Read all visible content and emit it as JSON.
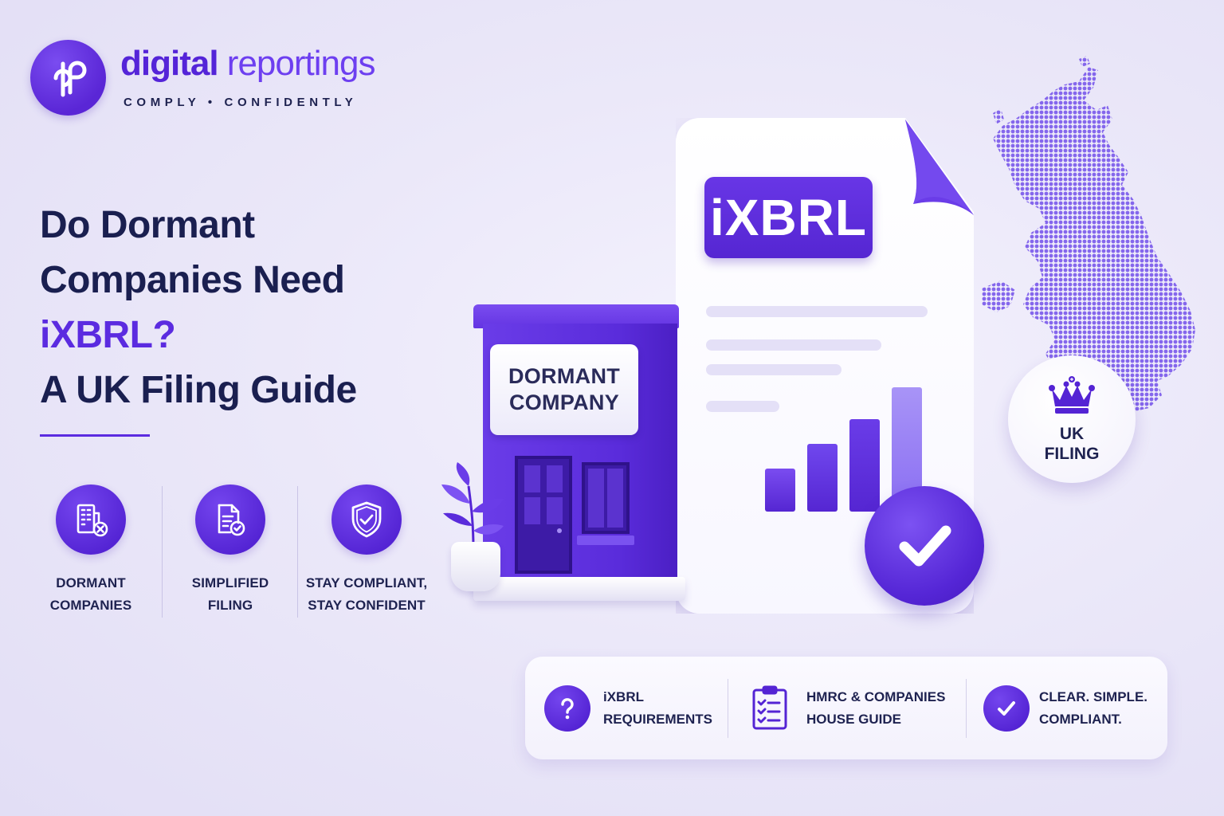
{
  "brand": {
    "name_part1": "digital",
    "name_part2": " reportings",
    "tagline": "COMPLY • CONFIDENTLY",
    "logo_icon": "dr-monogram-icon"
  },
  "headline": {
    "line1": "Do Dormant",
    "line2": "Companies Need",
    "line3": "iXBRL?",
    "line4": "A UK Filing Guide"
  },
  "features": [
    {
      "icon": "building-cross-icon",
      "label": "DORMANT\nCOMPANIES"
    },
    {
      "icon": "document-check-icon",
      "label": "SIMPLIFIED\nFILING"
    },
    {
      "icon": "shield-check-icon",
      "label": "STAY COMPLIANT,\nSTAY CONFIDENT"
    }
  ],
  "illustration": {
    "document_badge": "iXBRL",
    "store_sign_line1": "DORMANT",
    "store_sign_line2": "COMPANY",
    "uk_badge_line1": "UK",
    "uk_badge_line2": "FILING",
    "uk_badge_icon": "crown-icon",
    "document_bars": [
      0.32,
      0.5,
      0.68,
      0.92
    ],
    "colors": {
      "accent": "#5b2be0",
      "accent_light": "#9a82f4",
      "navy": "#1a1f50"
    }
  },
  "panel": [
    {
      "icon": "question-icon",
      "text": "iXBRL\nREQUIREMENTS"
    },
    {
      "icon": "clipboard-checklist-icon",
      "text": "HMRC & COMPANIES\nHOUSE GUIDE"
    },
    {
      "icon": "check-circle-icon",
      "text": "CLEAR. SIMPLE.\nCOMPLIANT."
    }
  ]
}
